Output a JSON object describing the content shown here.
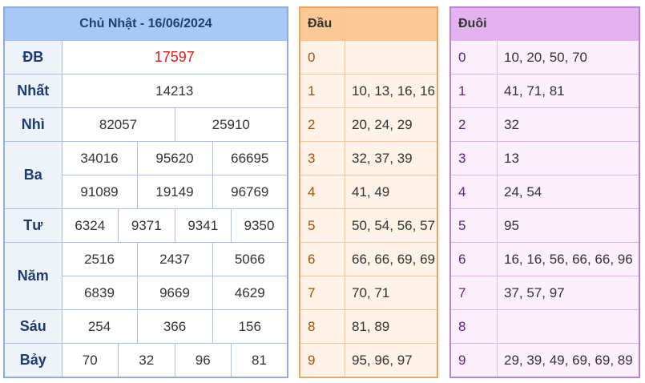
{
  "results": {
    "title": "Chủ Nhật - 16/06/2024",
    "rows": [
      {
        "label": "ĐB",
        "values": [
          "17597"
        ]
      },
      {
        "label": "Nhất",
        "values": [
          "14213"
        ]
      },
      {
        "label": "Nhì",
        "values": [
          "82057",
          "25910"
        ]
      },
      {
        "label": "Ba",
        "values": [
          "34016",
          "95620",
          "66695",
          "91089",
          "19149",
          "96769"
        ]
      },
      {
        "label": "Tư",
        "values": [
          "6324",
          "9371",
          "9341",
          "9350"
        ]
      },
      {
        "label": "Năm",
        "values": [
          "2516",
          "2437",
          "5066",
          "6839",
          "9669",
          "4629"
        ]
      },
      {
        "label": "Sáu",
        "values": [
          "254",
          "366",
          "156"
        ]
      },
      {
        "label": "Bảy",
        "values": [
          "70",
          "32",
          "96",
          "81"
        ]
      }
    ]
  },
  "heads": {
    "title": "Đầu",
    "rows": [
      {
        "digit": "0",
        "values": ""
      },
      {
        "digit": "1",
        "values": "10, 13, 16, 16"
      },
      {
        "digit": "2",
        "values": "20, 24, 29"
      },
      {
        "digit": "3",
        "values": "32, 37, 39"
      },
      {
        "digit": "4",
        "values": "41, 49"
      },
      {
        "digit": "5",
        "values": "50, 54, 56, 57"
      },
      {
        "digit": "6",
        "values": "66, 66, 69, 69"
      },
      {
        "digit": "7",
        "values": "70, 71"
      },
      {
        "digit": "8",
        "values": "81, 89"
      },
      {
        "digit": "9",
        "values": "95, 96, 97"
      }
    ]
  },
  "tails": {
    "title": "Đuôi",
    "rows": [
      {
        "digit": "0",
        "values": "10, 20, 50, 70"
      },
      {
        "digit": "1",
        "values": "41, 71, 81"
      },
      {
        "digit": "2",
        "values": "32"
      },
      {
        "digit": "3",
        "values": "13"
      },
      {
        "digit": "4",
        "values": "24, 54"
      },
      {
        "digit": "5",
        "values": "95"
      },
      {
        "digit": "6",
        "values": "16, 16, 56, 66, 66, 96"
      },
      {
        "digit": "7",
        "values": "37, 57, 97"
      },
      {
        "digit": "8",
        "values": ""
      },
      {
        "digit": "9",
        "values": "29, 39, 49, 69, 69, 89"
      }
    ]
  },
  "colors": {
    "result_header_bg": "#a9c8f5",
    "special_prize_text": "#e11b1b",
    "heads_header_bg": "#fbc896",
    "tails_header_bg": "#e4b3ef"
  }
}
